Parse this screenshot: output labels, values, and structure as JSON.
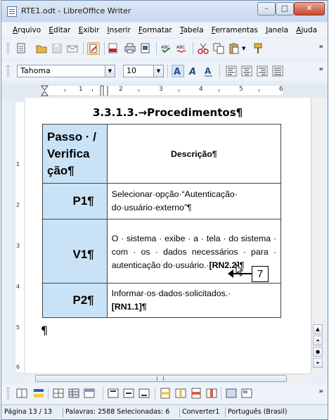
{
  "window": {
    "title": "RTE1.odt - LibreOffice Writer",
    "controls": {
      "minimize": "–",
      "maximize": "□",
      "close": "✕"
    }
  },
  "menu": [
    {
      "label": "Arquivo"
    },
    {
      "label": "Editar"
    },
    {
      "label": "Exibir"
    },
    {
      "label": "Inserir"
    },
    {
      "label": "Formatar"
    },
    {
      "label": "Tabela"
    },
    {
      "label": "Ferramentas"
    },
    {
      "label": "Janela"
    },
    {
      "label": "Ajuda"
    }
  ],
  "formatting": {
    "font_name": "Tahoma",
    "font_size": "10",
    "dropdown_arrow": "▼",
    "more_buttons": "»"
  },
  "ruler": {
    "marks": [
      "1",
      "2",
      "3",
      "4",
      "5",
      "6"
    ]
  },
  "vertical_ruler": {
    "marks": [
      "1",
      "2",
      "3",
      "4",
      "5",
      "6"
    ]
  },
  "document": {
    "heading": "3.3.1.3.→Procedimentos¶",
    "table": {
      "header_step": "Passo · / Verifica ção¶",
      "header_step_lines": [
        "Passo · /",
        "Verifica",
        "ção¶"
      ],
      "header_desc": "Descrição¶",
      "rows": [
        {
          "step": "P1¶",
          "description": "Selecionar·opção·“Autenticação· do·usuário·externo”¶"
        },
        {
          "step": "V1¶",
          "description": "O · sistema · exibe · a · tela · do sistema · com · os · dados necessários · para · autenticação do·usuário.·",
          "reference": "[RN2.2]¶"
        },
        {
          "step": "P2¶",
          "description": "Informar·os·dados·solicitados.·",
          "reference": "[RN1.1]¶"
        }
      ]
    },
    "trailing_paragraph_mark": "¶",
    "callout_number": "7"
  },
  "statusbar": {
    "page": "Página 13 / 13",
    "words": "Palavras: 2588 Selecionadas: 6",
    "mode": "Converter1",
    "language": "Português (Brasil)"
  },
  "icons": {
    "toolbar1": [
      "new-document-icon",
      "open-folder-icon",
      "save-disabled-icon",
      "email-icon",
      "edit-mode-icon",
      "export-pdf-icon",
      "print-icon",
      "print-preview-icon",
      "spellcheck-icon",
      "autospellcheck-icon",
      "cut-icon",
      "copy-icon",
      "paste-icon",
      "clone-formatting-icon"
    ],
    "toolbar2": [
      "bold-a-icon",
      "italic-a-icon",
      "underline-a-icon",
      "align-left-icon",
      "align-center-icon",
      "align-right-icon",
      "justify-icon"
    ],
    "toolbar3": [
      "borders-icon",
      "border-color-icon",
      "merge-cells-icon",
      "split-cells-icon",
      "table-autoformat-icon",
      "align-top-icon",
      "align-middle-icon",
      "align-bottom-icon",
      "insert-rows-icon",
      "insert-columns-icon",
      "delete-rows-icon",
      "delete-columns-icon",
      "select-table-icon",
      "table-properties-icon"
    ]
  }
}
